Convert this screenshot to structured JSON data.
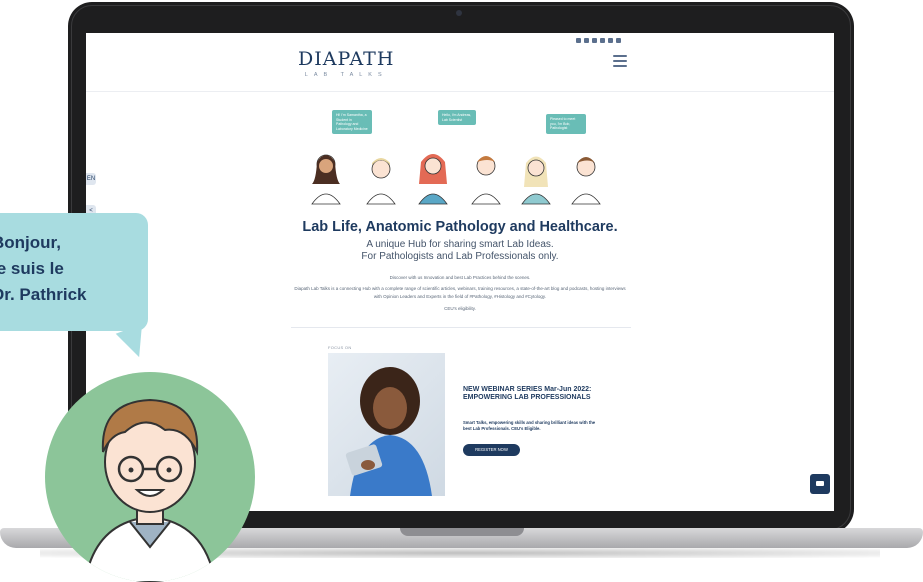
{
  "site": {
    "logo_main": "DIAPATH",
    "logo_sub": "LAB TALKS",
    "hero_title": "Lab Life, Anatomic Pathology and Healthcare.",
    "hero_sub_1": "A unique Hub for sharing smart Lab Ideas.",
    "hero_sub_2": "For Pathologists and Lab Professionals only.",
    "discover_line": "Discover with us Innovation and best Lab Practices behind the scenes.",
    "hub_line_1": "Diapath Lab Talks is a connecting Hub with a complete range of scientific articles, webinars, training resources, a state-of-the-art blog and podcasts, hosting interviews",
    "hub_line_2": "with Opinion Leaders and Experts in the field of #Pathology, #Histology and #Cytology.",
    "ceu_line": "CEU's eligibility.",
    "focus_label": "FOCUS ON",
    "promo_title": "NEW WEBINAR SERIES Mar-Jun 2022: EMPOWERING LAB PROFESSIONALS",
    "promo_text": "Smart Talks, empowering skills and sharing brilliant ideas with the best Lab Professionals. CEU's Eligible.",
    "register_label": "REGISTER NOW",
    "side_tab_1": "EN",
    "side_tab_2": "<",
    "bubbles": [
      "Hi! I'm Samantha, a Student in Pathology and Laboratory Medicine",
      "Hello, I'm Andreas, Lab Scientist",
      "Pleased to meet you, I'm Bob, Pathologist"
    ]
  },
  "overlay": {
    "speech_line_1": "Bonjour,",
    "speech_line_2": "je suis le",
    "speech_line_3": "Dr. Pathrick"
  },
  "colors": {
    "navy": "#1e3a5f",
    "teal_bubble": "#69bdb6",
    "speech_bg": "#a8dce0",
    "avatar_bg": "#8cc599"
  }
}
